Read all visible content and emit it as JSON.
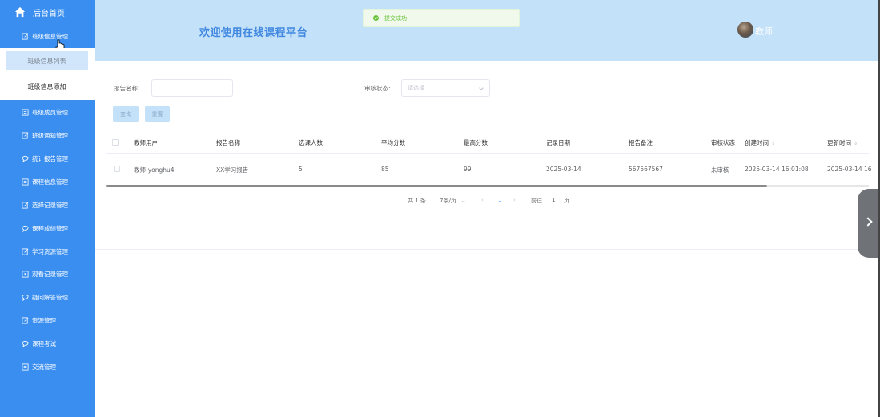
{
  "sidebar": {
    "home_label": "后台首页",
    "items": [
      {
        "label": "班级信息管理",
        "icon": "edit-icon"
      },
      {
        "label": "班级成员管理",
        "icon": "document-icon"
      },
      {
        "label": "班级通知管理",
        "icon": "edit-icon"
      },
      {
        "label": "统计报告管理",
        "icon": "chat-icon"
      },
      {
        "label": "课程信息管理",
        "icon": "document-icon"
      },
      {
        "label": "选择记录管理",
        "icon": "edit-icon"
      },
      {
        "label": "课程成绩管理",
        "icon": "chat-icon"
      },
      {
        "label": "学习资源管理",
        "icon": "edit-icon"
      },
      {
        "label": "观看记录管理",
        "icon": "play-box-icon"
      },
      {
        "label": "疑问解答管理",
        "icon": "chat-icon"
      },
      {
        "label": "资源管理",
        "icon": "edit-icon"
      },
      {
        "label": "课程考试",
        "icon": "chat-icon"
      },
      {
        "label": "交流管理",
        "icon": "document-icon"
      }
    ],
    "submenu": [
      {
        "label": "班级信息列表",
        "active": true
      },
      {
        "label": "班级信息添加",
        "active": false
      }
    ]
  },
  "header": {
    "title": "欢迎使用在线课程平台",
    "user_name": "教师"
  },
  "toast": {
    "message": "提交成功!",
    "color": "#67c23a"
  },
  "search": {
    "name_label": "报告名称:",
    "name_value": "",
    "status_label": "审核状态:",
    "status_placeholder": "请选择",
    "search_button": "查询",
    "reset_button": "重置"
  },
  "table": {
    "columns": [
      "教师用户",
      "报告名称",
      "选课人数",
      "平均分数",
      "最高分数",
      "记录日期",
      "报告备注",
      "审核状态",
      "创建时间",
      "更新时间"
    ],
    "rows": [
      [
        "教师-yonghu4",
        "XX学习报告",
        "5",
        "85",
        "99",
        "2025-03-14",
        "567567567",
        "未审核",
        "2025-03-14 16:01:08",
        "2025-03-14 16"
      ]
    ]
  },
  "pagination": {
    "total": "共 1 条",
    "page_size": "7条/页",
    "current_page": "1",
    "goto_label": "前往",
    "goto_value": "1",
    "page_suffix": "页"
  },
  "colors": {
    "sidebar": "#3a8ef0",
    "header": "#c3e1f9",
    "accent": "#409eff"
  }
}
